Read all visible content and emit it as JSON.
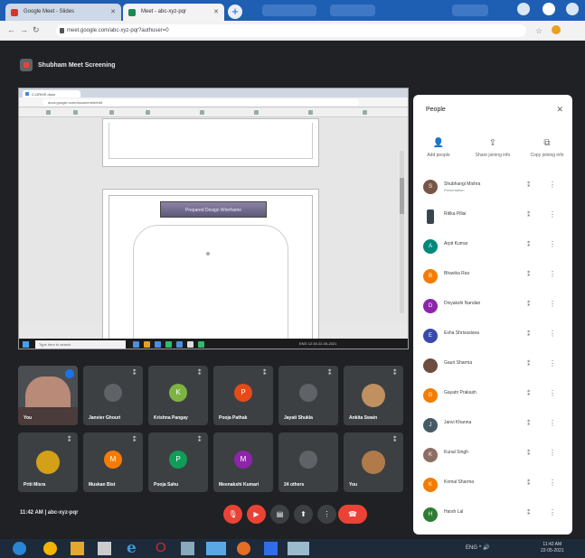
{
  "browser": {
    "tabs": [
      {
        "label": "Google Meet - Slides"
      },
      {
        "label": "Meet - abc-xyz-pqr"
      }
    ],
    "new_tab": "+",
    "url": "meet.google.com/abc-xyz-pqr?authuser=0"
  },
  "meet": {
    "title": "Shubham Meet Screening",
    "shared_screen": {
      "tab_label": "C-DRIVE docs",
      "url": "docs.google.com/document/d/edit",
      "heading": "Prepared Design Wireframe",
      "search_placeholder": "Type here to search",
      "tray": "ENG 12:30  22-05-2021"
    },
    "tiles": [
      {
        "name": "You",
        "initial": "",
        "color": "#4a4e52",
        "type": "self"
      },
      {
        "name": "Janvier Ghouri",
        "initial": "",
        "color": "#5f6368"
      },
      {
        "name": "Krishna Pangay",
        "initial": "K",
        "color": "#7cb342"
      },
      {
        "name": "Pooja Pathak",
        "initial": "P",
        "color": "#e64a19"
      },
      {
        "name": "Jayati Shukla",
        "initial": "",
        "color": "#5f6368"
      },
      {
        "name": "Ankita Swain",
        "initial": "",
        "color": "#c09060",
        "type": "photo"
      },
      {
        "name": "Priti Misra",
        "initial": "",
        "color": "#d4a017",
        "type": "photo"
      },
      {
        "name": "Muskan Bist",
        "initial": "M",
        "color": "#f57c00"
      },
      {
        "name": "Pooja Sahu",
        "initial": "P",
        "color": "#0f9d58"
      },
      {
        "name": "Meenakshi Kumari",
        "initial": "M",
        "color": "#8e24aa"
      },
      {
        "name": "24 others",
        "initial": "",
        "color": "#5f6368"
      },
      {
        "name": "You",
        "initial": "",
        "color": "#c09060",
        "type": "photo"
      }
    ],
    "bottom": {
      "time_label": "11:42 AM  |  abc-xyz-pqr",
      "end_call": "☎"
    },
    "people_panel": {
      "title": "People",
      "actions": [
        {
          "icon": "add-person",
          "label": "Add people"
        },
        {
          "icon": "share",
          "label": "Share joining info"
        },
        {
          "icon": "copy",
          "label": "Copy joining info"
        }
      ],
      "participants": [
        {
          "name": "Shubhangi Mishra",
          "sub": "Presentation",
          "initial": "S",
          "color": "#795548"
        },
        {
          "name": "Ritika Pillai",
          "sub": "",
          "initial": "",
          "color": "#37474f"
        },
        {
          "name": "Arpit Kumar",
          "sub": "",
          "initial": "A",
          "color": "#00897b"
        },
        {
          "name": "Bhavika Rao",
          "sub": "",
          "initial": "B",
          "color": "#f57c00"
        },
        {
          "name": "Divyakshi Nandan",
          "sub": "",
          "initial": "D",
          "color": "#8e24aa"
        },
        {
          "name": "Esha Shrivastava",
          "sub": "",
          "initial": "E",
          "color": "#3949ab"
        },
        {
          "name": "Gauri Sharma",
          "sub": "",
          "initial": "",
          "color": "#6d4c41"
        },
        {
          "name": "Gayatri Prakash",
          "sub": "",
          "initial": "G",
          "color": "#f57c00"
        },
        {
          "name": "Janvi Khanna",
          "sub": "",
          "initial": "J",
          "color": "#455a64"
        },
        {
          "name": "Kunal Singh",
          "sub": "",
          "initial": "K",
          "color": "#8d6e63"
        },
        {
          "name": "Komal Sharma",
          "sub": "",
          "initial": "K",
          "color": "#f57c00"
        },
        {
          "name": "Harsh Lal",
          "sub": "",
          "initial": "H",
          "color": "#2e7d32"
        }
      ]
    }
  },
  "taskbar": {
    "tray": "ENG  ^  🔊",
    "clock_time": "11:42 AM",
    "clock_date": "22-05-2021"
  }
}
